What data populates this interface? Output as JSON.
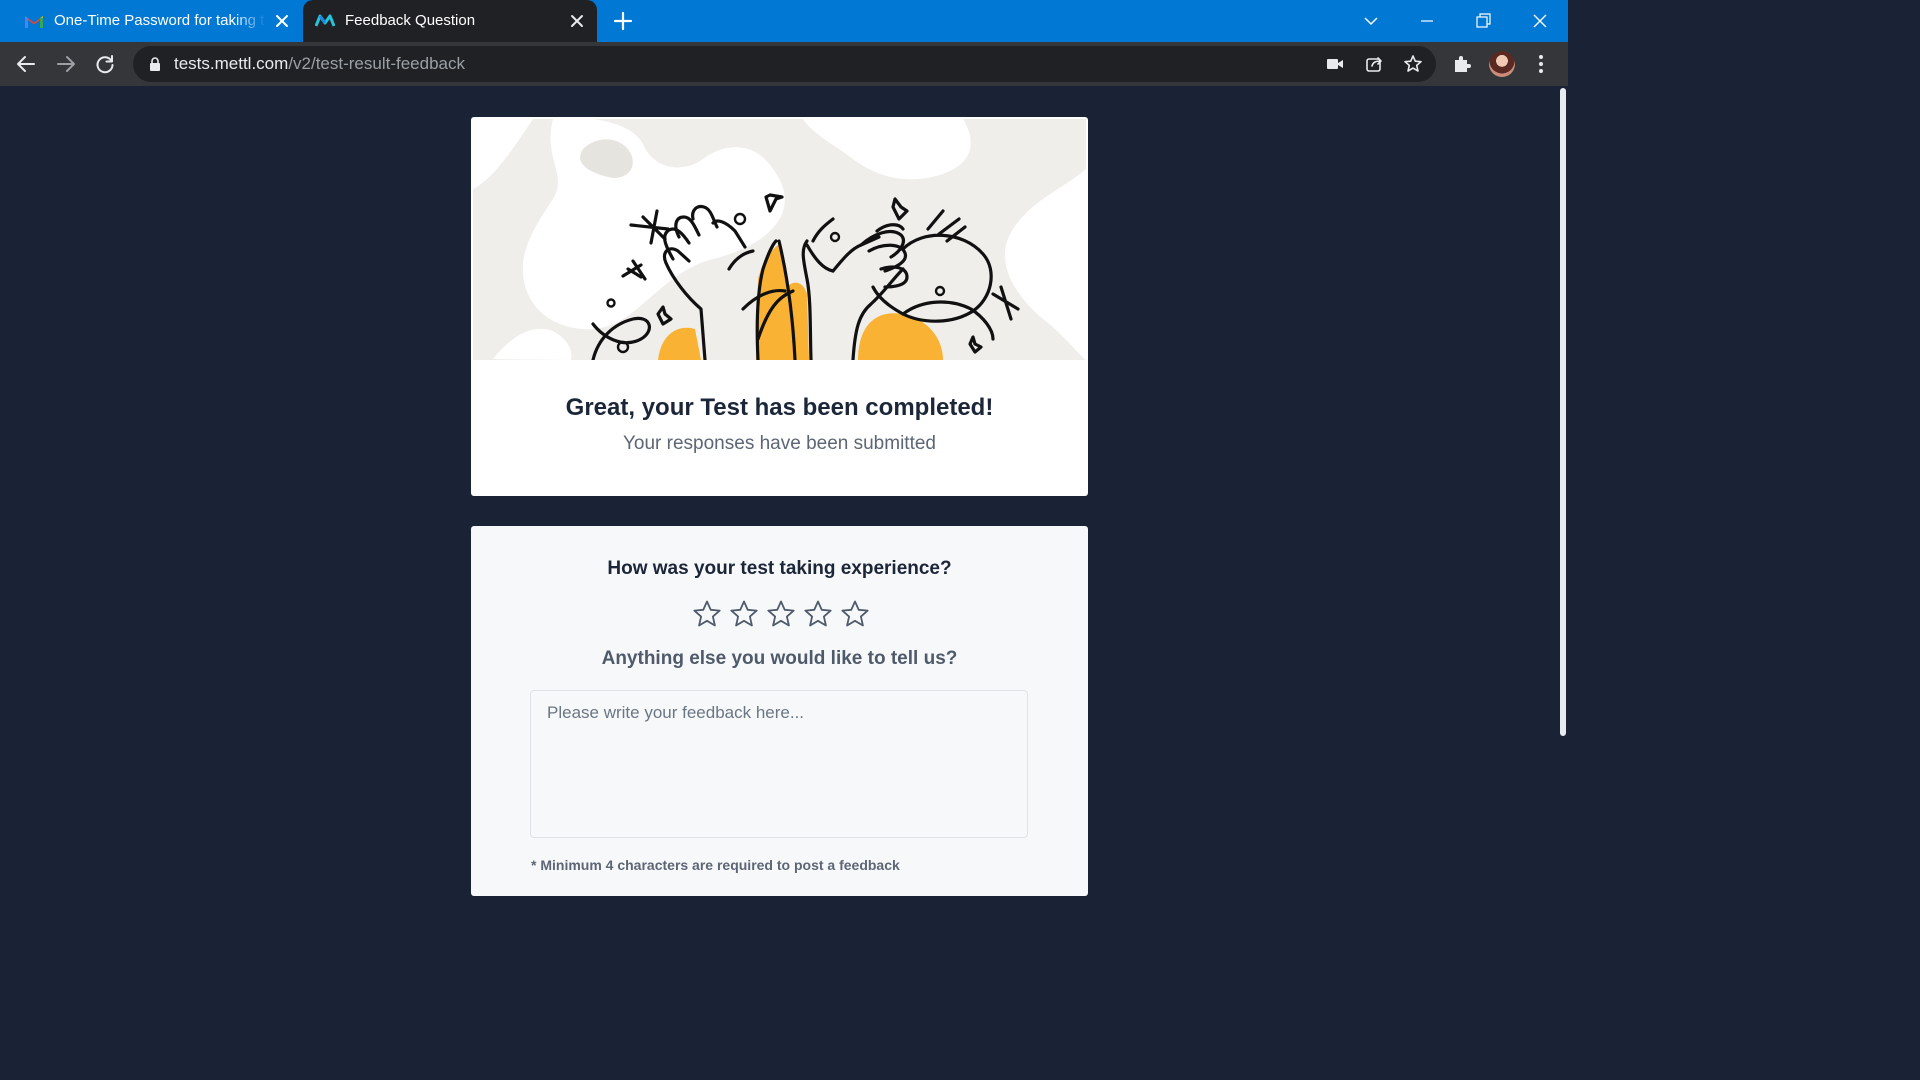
{
  "browser": {
    "tabs": [
      {
        "title": "One-Time Password for taking the",
        "favicon": "gmail-icon",
        "active": false
      },
      {
        "title": "Feedback Question",
        "favicon": "mettl-icon",
        "active": true
      }
    ],
    "url_host": "tests.mettl.com",
    "url_path": "/v2/test-result-feedback",
    "accent_color": "#0078d4"
  },
  "result_card": {
    "headline": "Great, your Test has been completed!",
    "subline": "Your responses have been submitted"
  },
  "feedback_card": {
    "question": "How was your test taking experience?",
    "rating_max": 5,
    "rating_value": 0,
    "prompt": "Anything else you would like to tell us?",
    "textarea_placeholder": "Please write your feedback here...",
    "textarea_value": "",
    "hint": "* Minimum 4 characters are required to post a feedback"
  },
  "colors": {
    "page_background": "#1a2235",
    "illustration_accent": "#f9b233"
  }
}
